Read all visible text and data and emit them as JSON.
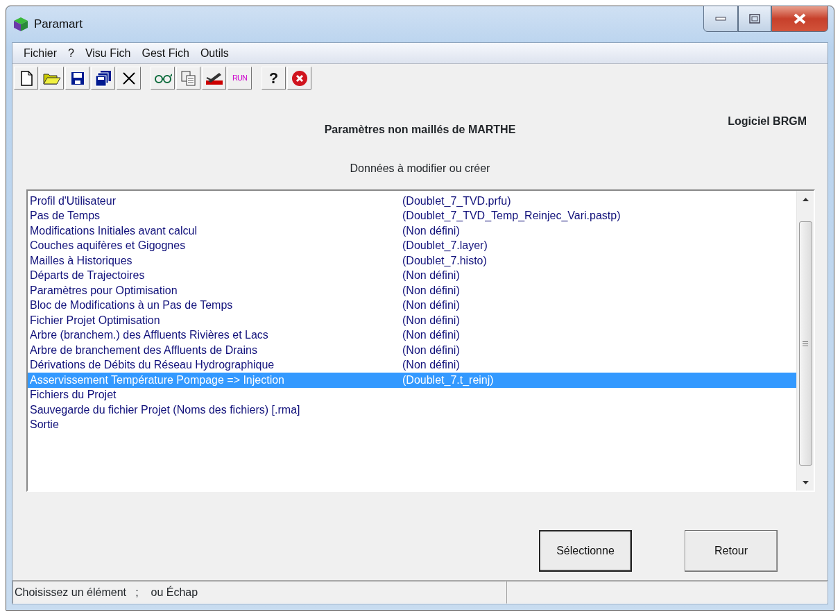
{
  "window": {
    "title": "Paramart"
  },
  "menu": [
    "Fichier",
    "?",
    "Visu Fich",
    "Gest Fich",
    "Outils"
  ],
  "toolbar": [
    {
      "kind": "new"
    },
    {
      "kind": "open"
    },
    {
      "kind": "save"
    },
    {
      "kind": "saveall"
    },
    {
      "kind": "delete",
      "gap_after": true
    },
    {
      "kind": "glasses"
    },
    {
      "kind": "copy"
    },
    {
      "kind": "edit"
    },
    {
      "kind": "text",
      "label": "RUN",
      "gap_after": true
    },
    {
      "kind": "text",
      "label": "?"
    },
    {
      "kind": "stop"
    }
  ],
  "vendor": "Logiciel BRGM",
  "heading": "Paramètres non maillés de MARTHE",
  "subheading": "Données à modifier ou créer",
  "list": [
    {
      "label": "Profil d'Utilisateur",
      "file": "(Doublet_7_TVD.prfu)",
      "selected": false
    },
    {
      "label": "Pas de Temps",
      "file": "(Doublet_7_TVD_Temp_Reinjec_Vari.pastp)",
      "selected": false
    },
    {
      "label": "Modifications Initiales avant calcul",
      "file": "(Non défini)",
      "selected": false
    },
    {
      "label": "Couches aquifères et Gigognes",
      "file": "(Doublet_7.layer)",
      "selected": false
    },
    {
      "label": "Mailles à Historiques",
      "file": "(Doublet_7.histo)",
      "selected": false
    },
    {
      "label": "Départs de Trajectoires",
      "file": "(Non défini)",
      "selected": false
    },
    {
      "label": "Paramètres pour Optimisation",
      "file": "(Non défini)",
      "selected": false
    },
    {
      "label": "Bloc de Modifications à un Pas de Temps",
      "file": "(Non défini)",
      "selected": false
    },
    {
      "label": "Fichier Projet Optimisation",
      "file": "(Non défini)",
      "selected": false
    },
    {
      "label": "Arbre (branchem.) des Affluents Rivières et Lacs",
      "file": "(Non défini)",
      "selected": false
    },
    {
      "label": "Arbre de branchement des Affluents de Drains",
      "file": "(Non défini)",
      "selected": false
    },
    {
      "label": "Dérivations de Débits du Réseau Hydrographique",
      "file": "(Non défini)",
      "selected": false
    },
    {
      "label": "Asservissement Température Pompage => Injection",
      "file": "(Doublet_7.t_reinj)",
      "selected": true
    },
    {
      "label": "Fichiers du Projet",
      "selected": false
    },
    {
      "label": "Sauvegarde du fichier Projet (Noms des fichiers) [.rma]",
      "selected": false
    },
    {
      "label": "Sortie",
      "selected": false
    }
  ],
  "buttons": [
    {
      "label": "Sélectionne",
      "default": true
    },
    {
      "label": "Retour",
      "default": false
    }
  ],
  "status_bar": [
    "Choisissez un élément   ;    ou Échap"
  ]
}
